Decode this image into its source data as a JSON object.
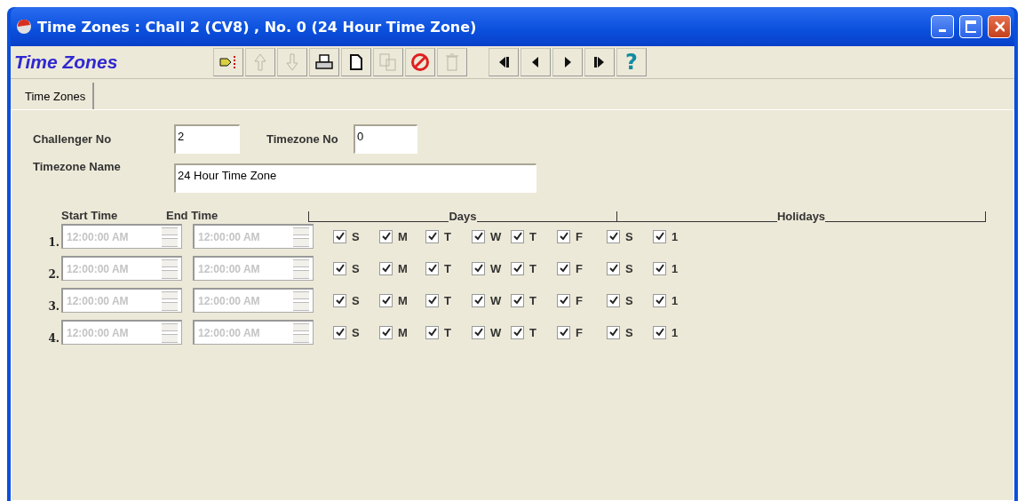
{
  "window": {
    "title": "Time Zones : Chall 2 (CV8) , No. 0 (24 Hour Time Zone)"
  },
  "form_title": "Time Zones",
  "toolbar": [
    {
      "kind": "exit",
      "disabled": false
    },
    {
      "kind": "up",
      "disabled": true
    },
    {
      "kind": "down",
      "disabled": true
    },
    {
      "kind": "print",
      "disabled": false
    },
    {
      "kind": "new",
      "disabled": false
    },
    {
      "kind": "copy",
      "disabled": true
    },
    {
      "kind": "cancel",
      "disabled": false
    },
    {
      "kind": "delete",
      "disabled": true
    },
    {
      "kind": "first",
      "disabled": false
    },
    {
      "kind": "prev",
      "disabled": false
    },
    {
      "kind": "next",
      "disabled": false
    },
    {
      "kind": "last",
      "disabled": false
    },
    {
      "kind": "help",
      "disabled": false,
      "text": "?"
    }
  ],
  "tabs": [
    {
      "label": "Time Zones",
      "selected": true
    }
  ],
  "fields": {
    "challenger_no": {
      "label": "Challenger No",
      "value": "2"
    },
    "timezone_no": {
      "label": "Timezone No",
      "value": "0"
    },
    "timezone_name": {
      "label": "Timezone Name",
      "value": "24 Hour Time Zone"
    }
  },
  "headers": {
    "start_time": "Start Time",
    "end_time": "End Time",
    "days": "Days",
    "holidays": "Holidays"
  },
  "rows": [
    {
      "number": "1.",
      "start": {
        "value": "12:00:00 AM",
        "disabled": true
      },
      "end": {
        "value": "12:00:00 AM",
        "disabled": true
      },
      "days": [
        {
          "label": "S",
          "checked": true
        },
        {
          "label": "M",
          "checked": true
        },
        {
          "label": "T",
          "checked": true
        },
        {
          "label": "W",
          "checked": true
        },
        {
          "label": "T",
          "checked": true
        },
        {
          "label": "F",
          "checked": true
        },
        {
          "label": "S",
          "checked": true
        }
      ],
      "holidays": [
        {
          "label": "1",
          "checked": true
        }
      ]
    },
    {
      "number": "2.",
      "start": {
        "value": "12:00:00 AM",
        "disabled": true
      },
      "end": {
        "value": "12:00:00 AM",
        "disabled": true
      },
      "days": [
        {
          "label": "S",
          "checked": true
        },
        {
          "label": "M",
          "checked": true
        },
        {
          "label": "T",
          "checked": true
        },
        {
          "label": "W",
          "checked": true
        },
        {
          "label": "T",
          "checked": true
        },
        {
          "label": "F",
          "checked": true
        },
        {
          "label": "S",
          "checked": true
        }
      ],
      "holidays": [
        {
          "label": "1",
          "checked": true
        }
      ]
    },
    {
      "number": "3.",
      "start": {
        "value": "12:00:00 AM",
        "disabled": true
      },
      "end": {
        "value": "12:00:00 AM",
        "disabled": true
      },
      "days": [
        {
          "label": "S",
          "checked": true
        },
        {
          "label": "M",
          "checked": true
        },
        {
          "label": "T",
          "checked": true
        },
        {
          "label": "W",
          "checked": true
        },
        {
          "label": "T",
          "checked": true
        },
        {
          "label": "F",
          "checked": true
        },
        {
          "label": "S",
          "checked": true
        }
      ],
      "holidays": [
        {
          "label": "1",
          "checked": true
        }
      ]
    },
    {
      "number": "4.",
      "start": {
        "value": "12:00:00 AM",
        "disabled": true
      },
      "end": {
        "value": "12:00:00 AM",
        "disabled": true
      },
      "days": [
        {
          "label": "S",
          "checked": true
        },
        {
          "label": "M",
          "checked": true
        },
        {
          "label": "T",
          "checked": true
        },
        {
          "label": "W",
          "checked": true
        },
        {
          "label": "T",
          "checked": true
        },
        {
          "label": "F",
          "checked": true
        },
        {
          "label": "S",
          "checked": true
        }
      ],
      "holidays": [
        {
          "label": "1",
          "checked": true
        }
      ]
    }
  ]
}
